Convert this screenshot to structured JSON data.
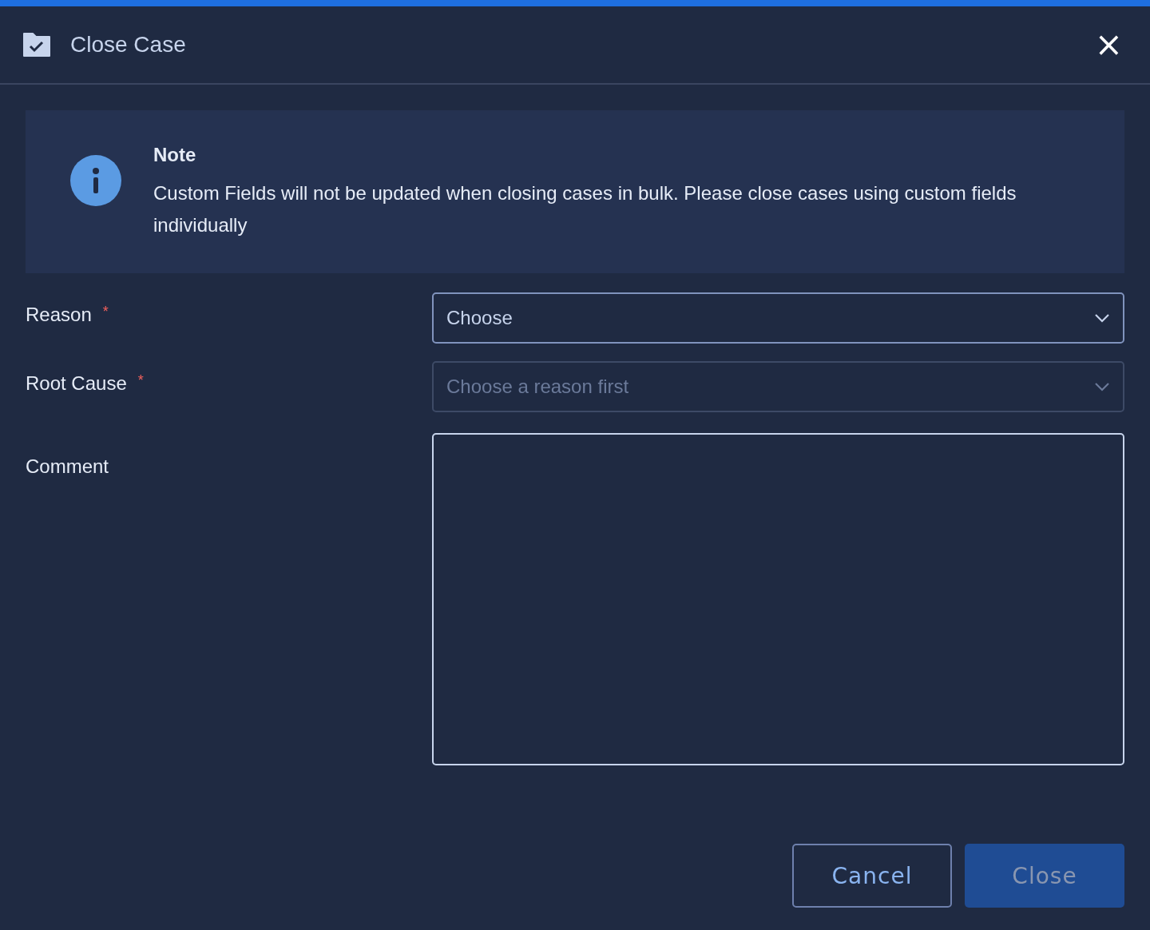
{
  "dialog": {
    "title": "Close Case",
    "close_icon": "×"
  },
  "note": {
    "title": "Note",
    "text": "Custom Fields will not be updated when closing cases in bulk. Please close cases using custom fields individually"
  },
  "fields": [
    {
      "kind": "select",
      "label": "Reason",
      "required_mark": "*",
      "value": "Choose",
      "disabled": false
    },
    {
      "kind": "select",
      "label": "Root Cause",
      "required_mark": "*",
      "placeholder": "Choose a reason first",
      "disabled": true
    },
    {
      "kind": "textarea",
      "label": "Comment"
    }
  ],
  "buttons": [
    {
      "kind": "secondary",
      "label": "Cancel",
      "disabled": false
    },
    {
      "kind": "primary",
      "label": "Close",
      "disabled": true
    }
  ]
}
